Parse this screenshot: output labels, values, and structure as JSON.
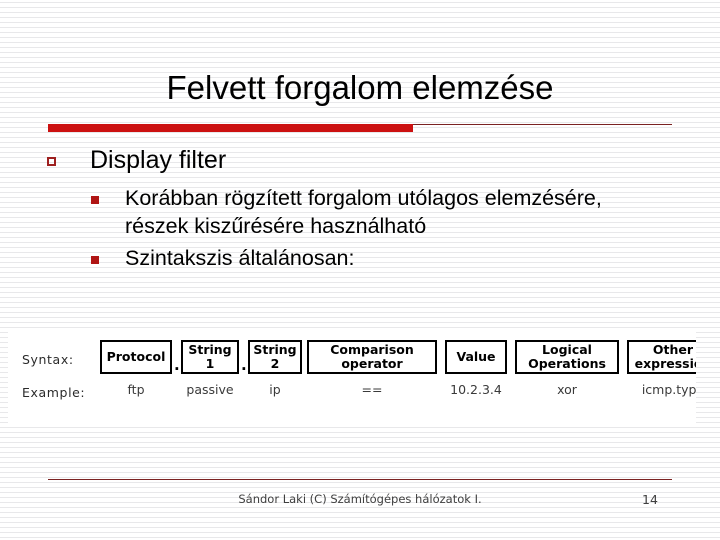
{
  "slide": {
    "title": "Felvett forgalom elemzése",
    "accent_color": "#cc1111",
    "rule_color": "#7b2222",
    "bullet_level1_color": "#9e2020",
    "bullet_level2_color": "#b01515",
    "bullets": [
      {
        "level": 1,
        "text": "Display filter"
      },
      {
        "level": 2,
        "text": "Korábban rögzített forgalom utólagos elemzésére, részek kiszűrésére használható"
      },
      {
        "level": 2,
        "text": "Szintakszis általánosan:"
      }
    ]
  },
  "syntax_diagram": {
    "row_labels": {
      "syntax": "Syntax:",
      "example": "Example:"
    },
    "separators": [
      ".",
      "."
    ],
    "columns": [
      {
        "syntax": "Protocol",
        "example": "ftp"
      },
      {
        "syntax": "String 1",
        "example": "passive"
      },
      {
        "syntax": "String 2",
        "example": "ip"
      },
      {
        "syntax": "Comparison operator",
        "example": "=="
      },
      {
        "syntax": "Value",
        "example": "10.2.3.4"
      },
      {
        "syntax": "Logical Operations",
        "example": "xor"
      },
      {
        "syntax": "Other expression",
        "example": "icmp.type"
      }
    ]
  },
  "footer": {
    "credit": "Sándor Laki (C) Számítógépes hálózatok I.",
    "page_number": "14"
  }
}
